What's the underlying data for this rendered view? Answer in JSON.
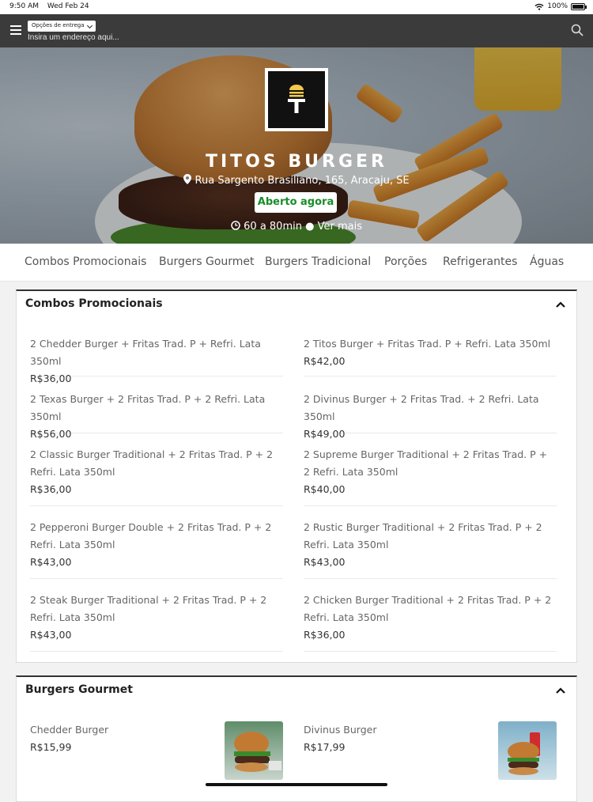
{
  "status_bar": {
    "time": "9:50 AM",
    "date": "Wed Feb 24",
    "battery": "100%"
  },
  "header": {
    "delivery_options_label": "Opções de entrega",
    "address_placeholder": "Insira um endereço aqui..."
  },
  "restaurant": {
    "name": "TITOS BURGER",
    "address": "Rua Sargento Brasiliano, 165, Aracaju, SE",
    "status": "Aberto agora",
    "delivery_time": "60 a 80min",
    "more_label": "Ver mais"
  },
  "categories": [
    "Combos Promocionais",
    "Burgers Gourmet",
    "Burgers Tradicional",
    "Porções",
    "Refrigerantes",
    "Águas"
  ],
  "sections": [
    {
      "title": "Combos Promocionais",
      "items": [
        {
          "name": "2 Chedder Burger + Fritas Trad. P + Refri. Lata 350ml",
          "price": "R$36,00"
        },
        {
          "name": "2 Titos Burger + Fritas Trad. P + Refri. Lata 350ml",
          "price": "R$42,00"
        },
        {
          "name": "2 Texas Burger + 2 Fritas Trad. P + 2 Refri. Lata 350ml",
          "price": "R$56,00"
        },
        {
          "name": "2 Divinus Burger + 2 Fritas Trad. + 2 Refri. Lata 350ml",
          "price": "R$49,00"
        },
        {
          "name": "2 Classic Burger Traditional + 2 Fritas Trad. P + 2 Refri. Lata 350ml",
          "price": "R$36,00"
        },
        {
          "name": "2 Supreme Burger Traditional + 2 Fritas Trad. P + 2 Refri. Lata 350ml",
          "price": "R$40,00"
        },
        {
          "name": "2 Pepperoni Burger Double + 2 Fritas Trad. P + 2 Refri. Lata 350ml",
          "price": "R$43,00"
        },
        {
          "name": "2 Rustic Burger Traditional + 2 Fritas Trad. P + 2 Refri. Lata 350ml",
          "price": "R$43,00"
        },
        {
          "name": "2 Steak Burger Traditional + 2 Fritas Trad. P + 2 Refri. Lata 350ml",
          "price": "R$43,00"
        },
        {
          "name": "2 Chicken Burger Traditional + 2 Fritas Trad. P + 2 Refri. Lata 350ml",
          "price": "R$36,00"
        }
      ]
    },
    {
      "title": "Burgers Gourmet",
      "items": [
        {
          "name": "Chedder Burger",
          "price": "R$15,99"
        },
        {
          "name": "Divinus Burger",
          "price": "R$17,99"
        }
      ]
    }
  ],
  "colors": {
    "open_badge_text": "#1a8c2a",
    "topbar": "#3b3b3b",
    "logo_accent": "#f2c94c"
  }
}
